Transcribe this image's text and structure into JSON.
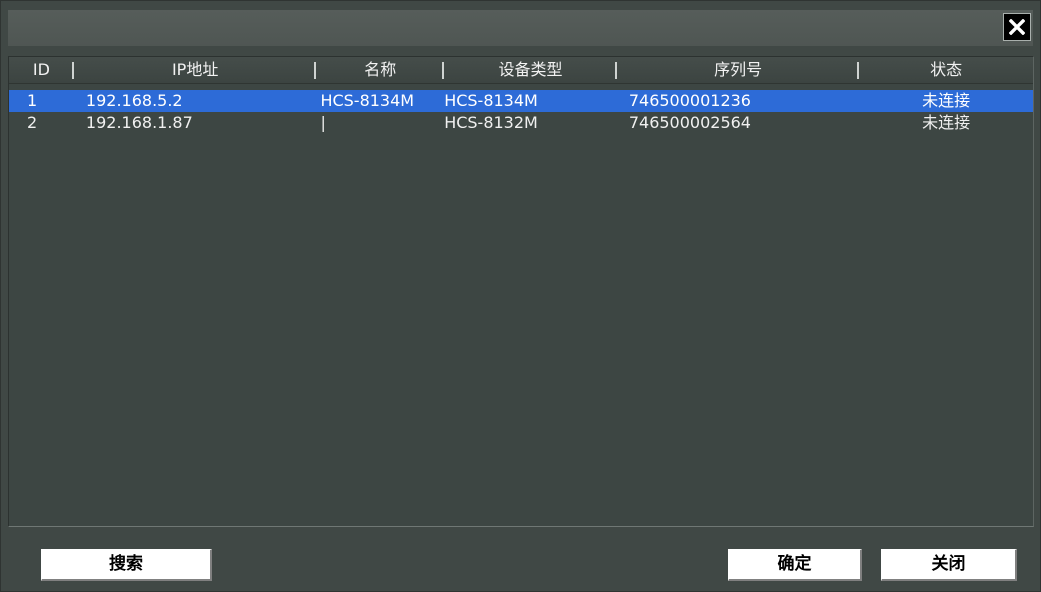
{
  "columns": {
    "id": "ID",
    "ip": "IP地址",
    "name": "名称",
    "type": "设备类型",
    "serial": "序列号",
    "status": "状态"
  },
  "rows": [
    {
      "id": "1",
      "ip": "192.168.5.2",
      "name": "HCS-8134M",
      "type": "HCS-8134M",
      "serial": "746500001236",
      "status": "未连接"
    },
    {
      "id": "2",
      "ip": "192.168.1.87",
      "name": "|",
      "type": "HCS-8132M",
      "serial": "746500002564",
      "status": "未连接"
    }
  ],
  "buttons": {
    "search": "搜索",
    "ok": "确定",
    "close": "关闭"
  },
  "colors": {
    "background": "#404845",
    "selection": "#2d6bd7"
  },
  "icons": {
    "close": "close-icon"
  }
}
